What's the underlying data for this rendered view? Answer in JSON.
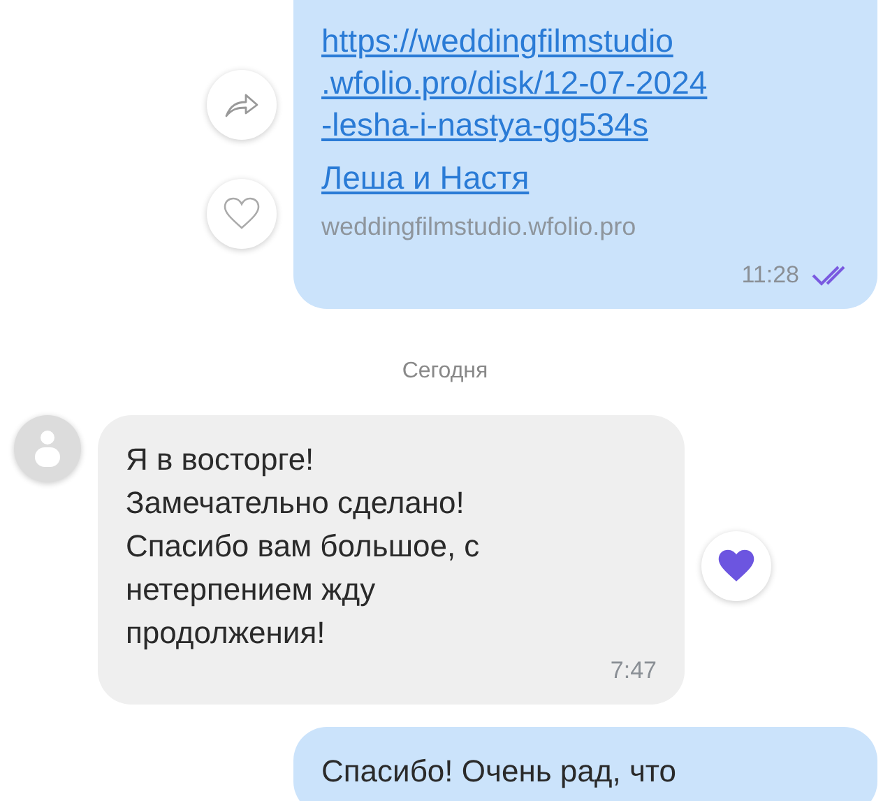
{
  "messages": [
    {
      "kind": "link",
      "link_lines": [
        "https://weddingfilmstudio",
        ".wfolio.pro/disk/12-07-2024",
        "-lesha-i-nastya-gg534s"
      ],
      "link_title": "Леша и Настя",
      "domain": "weddingfilmstudio.wfolio.pro",
      "time": "11:28",
      "read": true,
      "liked": false
    },
    {
      "kind": "date",
      "label": "Сегодня"
    },
    {
      "kind": "incoming",
      "lines": [
        "Я в восторге!",
        "Замечательно сделано!",
        "Спасибо вам большое, с",
        "нетерпением жду",
        "продолжения!"
      ],
      "time": "7:47",
      "liked": true
    },
    {
      "kind": "outgoing",
      "lines": [
        "Спасибо! Очень рад, что"
      ]
    }
  ]
}
